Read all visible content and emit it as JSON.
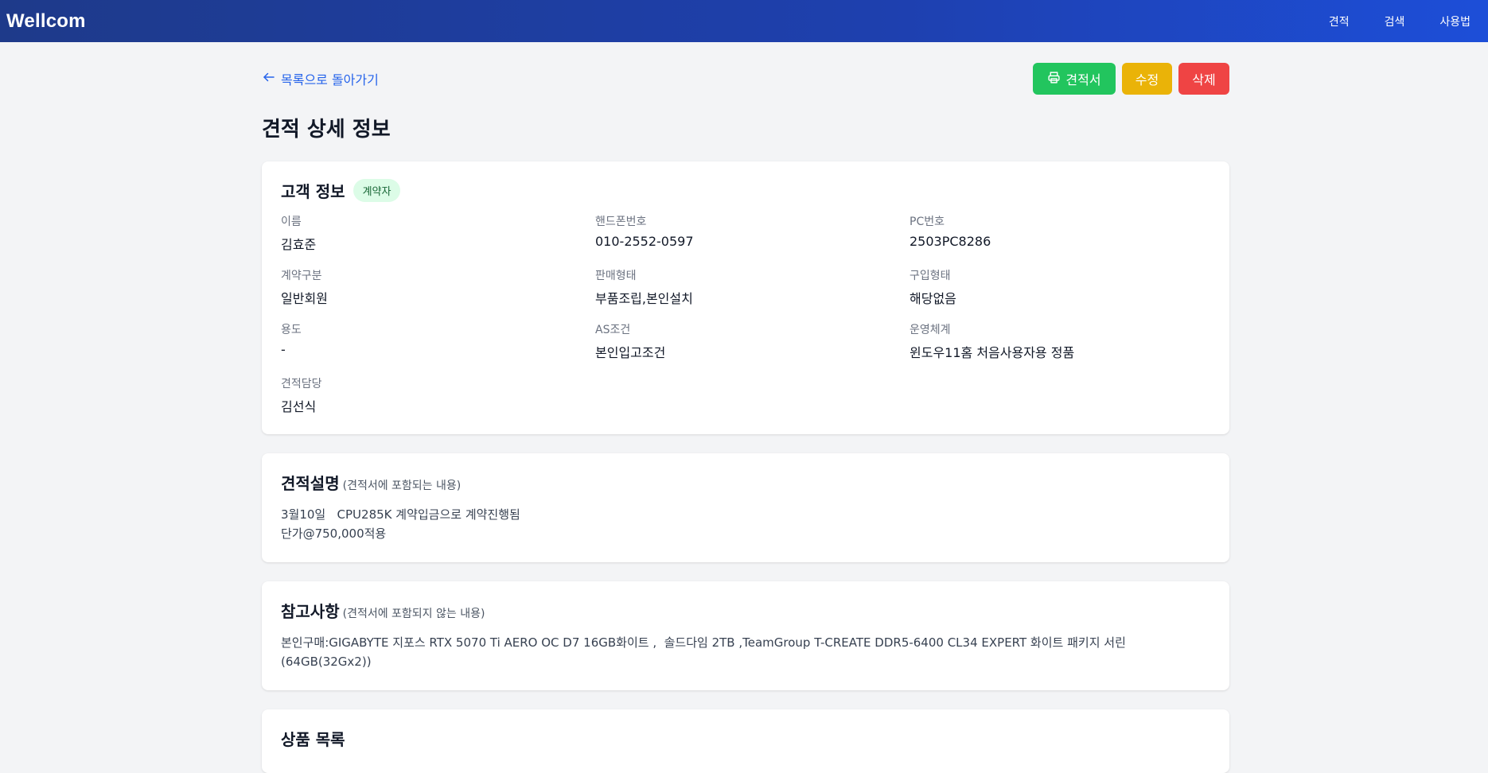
{
  "navbar": {
    "brand": "Wellcom",
    "links": [
      "견적",
      "검색",
      "사용법"
    ]
  },
  "topbar": {
    "back_label": "목록으로 돌아가기",
    "print_label": "견적서",
    "edit_label": "수정",
    "delete_label": "삭제"
  },
  "page": {
    "title": "견적 상세 정보"
  },
  "customer": {
    "title": "고객 정보",
    "badge": "계약자",
    "fields": [
      {
        "label": "이름",
        "value": "김효준"
      },
      {
        "label": "핸드폰번호",
        "value": "010-2552-0597"
      },
      {
        "label": "PC번호",
        "value": "2503PC8286"
      },
      {
        "label": "계약구분",
        "value": "일반회원"
      },
      {
        "label": "판매형태",
        "value": "부품조립,본인설치"
      },
      {
        "label": "구입형태",
        "value": "해당없음"
      },
      {
        "label": "용도",
        "value": "-"
      },
      {
        "label": "AS조건",
        "value": "본인입고조건"
      },
      {
        "label": "운영체계",
        "value": "윈도우11홈 처음사용자용 정품"
      },
      {
        "label": "견적담당",
        "value": "김선식"
      }
    ]
  },
  "description": {
    "title": "견적설명",
    "subtitle": "(견적서에 포함되는 내용)",
    "text": "3월10일   CPU285K 계약입금으로 계약진행됨\n단가@750,000적용"
  },
  "notes": {
    "title": "참고사항",
    "subtitle": "(견적서에 포함되지 않는 내용)",
    "text": "본인구매:GIGABYTE 지포스 RTX 5070 Ti AERO OC D7 16GB화이트 ,  솔드다임 2TB ,TeamGroup T-CREATE DDR5-6400 CL34 EXPERT 화이트 패키지 서린\n(64GB(32Gx2))"
  },
  "products": {
    "title": "상품 목록"
  },
  "colors": {
    "nav_start": "#1e3a8a",
    "nav_end": "#1d4ed8",
    "print": "#22c55e",
    "edit": "#eab308",
    "delete": "#ef4444",
    "link": "#2563eb",
    "badge_bg": "#dcfce7",
    "badge_text": "#166534"
  }
}
